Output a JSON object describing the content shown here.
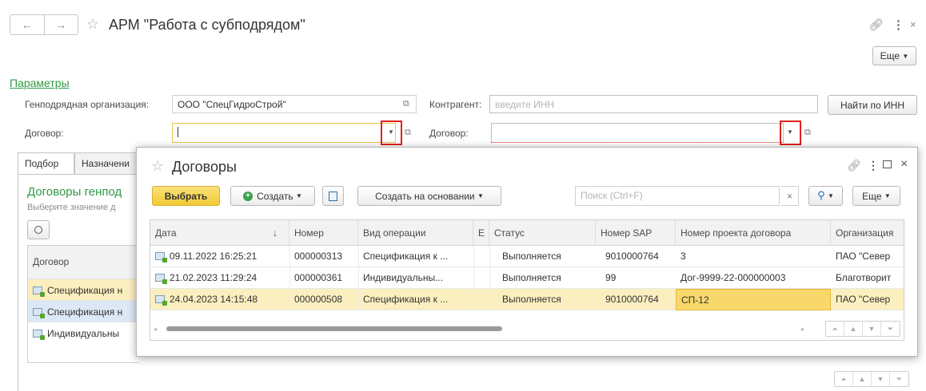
{
  "window": {
    "title": "АРМ \"Работа с субподрядом\"",
    "more_button": "Еще"
  },
  "params": {
    "section_title": "Параметры",
    "gen_org_label": "Генподрядная организация:",
    "gen_org_value": "ООО \"СпецГидроСтрой\"",
    "contract_label": "Договор:",
    "contract_value": "",
    "counterparty_label": "Контрагент:",
    "counterparty_placeholder": "введите ИНН",
    "find_by_inn_button": "Найти по ИНН",
    "contract2_label": "Договор:",
    "contract2_value": ""
  },
  "tabs": [
    "Подбор",
    "Назначени"
  ],
  "left_panel": {
    "title": "Договоры генпод",
    "hint": "Выберите значение д",
    "column": "Договор",
    "rows": [
      "Спецификация н",
      "Спецификация н",
      "Индивидуальны"
    ]
  },
  "dialog": {
    "title": "Договоры",
    "select_button": "Выбрать",
    "create_button": "Создать",
    "create_based_button": "Создать на основании",
    "search_placeholder": "Поиск (Ctrl+F)",
    "more_button": "Еще",
    "columns": [
      "Дата",
      "Номер",
      "Вид операции",
      "Е",
      "Статус",
      "Номер SAP",
      "Номер проекта договора",
      "Организация"
    ],
    "sort_indicator": "↓",
    "rows": [
      {
        "date": "09.11.2022 16:25:21",
        "number": "000000313",
        "op": "Спецификация к ...",
        "e": "",
        "status": "Выполняется",
        "sap": "9010000764",
        "project": "3",
        "org": "ПАО \"Север"
      },
      {
        "date": "21.02.2023 11:29:24",
        "number": "000000361",
        "op": "Индивидуальны...",
        "e": "",
        "status": "Выполняется",
        "sap": "99",
        "project": "Дог-9999-22-000000003",
        "org": "Благотворит"
      },
      {
        "date": "24.04.2023 14:15:48",
        "number": "000000508",
        "op": "Спецификация к ...",
        "e": "",
        "status": "Выполняется",
        "sap": "9010000764",
        "project": "СП-12",
        "org": "ПАО \"Север"
      }
    ]
  },
  "colors": {
    "accent_green": "#2f9a43",
    "select_yellow": "#f9d86b",
    "highlight_red": "#e0201c"
  }
}
